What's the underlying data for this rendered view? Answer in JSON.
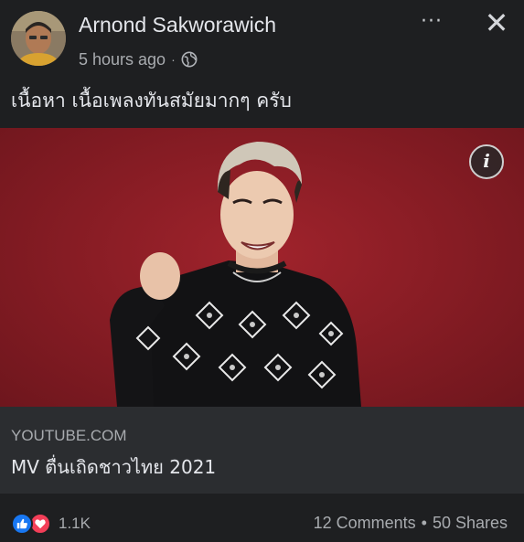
{
  "post": {
    "author": "Arnond Sakworawich",
    "time": "5 hours ago",
    "separator": "·",
    "privacy_icon": "globe-icon",
    "more_label": "···",
    "close_label": "✕",
    "caption": "เนื้อหา เนื้อเพลงทันสมัยมากๆ ครับ"
  },
  "link": {
    "info_label": "i",
    "domain": "YOUTUBE.COM",
    "title": "MV ตื่นเถิดชาวไทย 2021"
  },
  "footer": {
    "reaction_icons": [
      "like-icon",
      "love-icon"
    ],
    "reaction_count": "1.1K",
    "comments": "12 Comments",
    "separator": "•",
    "shares": "50 Shares"
  },
  "colors": {
    "background": "#1e1f21",
    "link_box": "#2b2d30",
    "preview_red": "#8a1d25",
    "like_blue": "#1877f2",
    "love_red": "#f33e58"
  }
}
